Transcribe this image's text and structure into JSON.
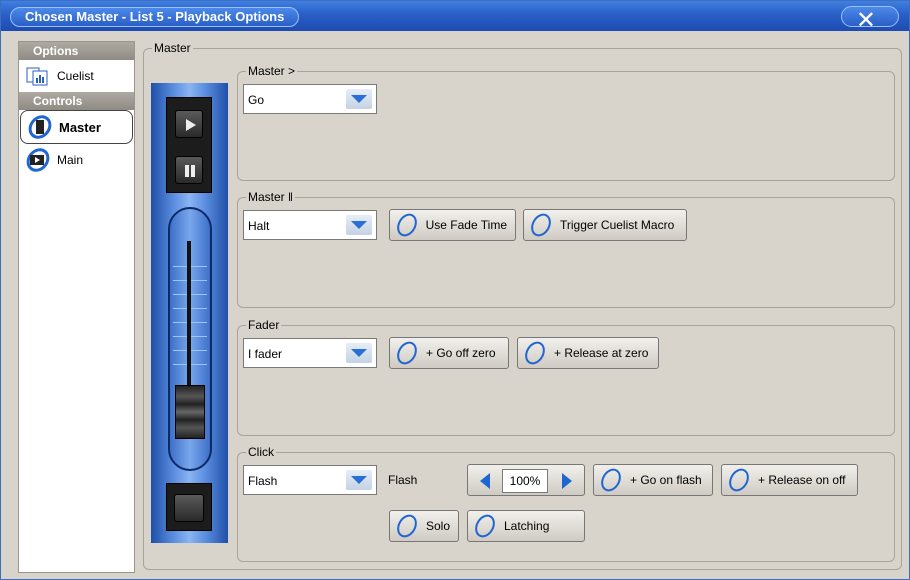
{
  "window": {
    "title": "Chosen Master - List 5 - Playback Options",
    "close_glyph": "✕"
  },
  "sidebar": {
    "options_header": "Options",
    "options_items": [
      {
        "label": "Cuelist",
        "icon": "cuelist-icon"
      }
    ],
    "controls_header": "Controls",
    "controls_items": [
      {
        "label": "Master",
        "icon": "master-icon",
        "active": true
      },
      {
        "label": "Main",
        "icon": "main-icon",
        "active": false
      }
    ]
  },
  "master": {
    "title": "Master",
    "go_group": {
      "title": "Master >",
      "combo_value": "Go"
    },
    "halt_group": {
      "title": "Master ‖",
      "combo_value": "Halt",
      "buttons": [
        "Use Fade Time",
        "Trigger Cuelist Macro"
      ]
    },
    "fader_group": {
      "title": "Fader",
      "combo_value": "I fader",
      "buttons": [
        "+ Go off zero",
        "+ Release at zero"
      ]
    },
    "click_group": {
      "title": "Click",
      "combo_value": "Flash",
      "flash_label": "Flash",
      "flash_level": "100%",
      "buttons": [
        "+ Go on flash",
        "+ Release on off",
        "Solo",
        "Latching"
      ]
    }
  },
  "colors": {
    "titlebar": "#2a5fc6",
    "accent_blue": "#1f66d0"
  }
}
